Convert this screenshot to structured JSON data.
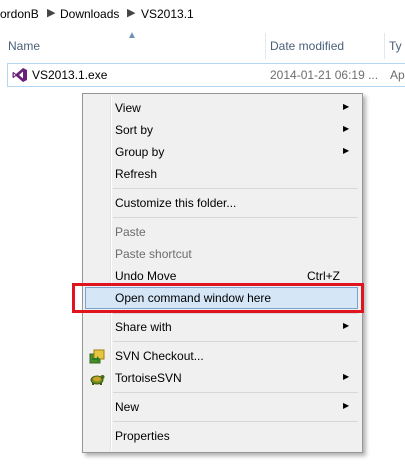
{
  "breadcrumb": {
    "items": [
      "ordonB",
      "Downloads",
      "VS2013.1"
    ],
    "separator": "▶"
  },
  "columns": {
    "name": "Name",
    "date_modified": "Date modified",
    "type": "Ty"
  },
  "file": {
    "name": "VS2013.1.exe",
    "date": "2014-01-21 06:19 ...",
    "type": "Ap",
    "icon": "visual-studio-icon"
  },
  "menu": {
    "view": "View",
    "sort_by": "Sort by",
    "group_by": "Group by",
    "refresh": "Refresh",
    "customize": "Customize this folder...",
    "paste": "Paste",
    "paste_shortcut": "Paste shortcut",
    "undo_move": "Undo Move",
    "undo_shortcut": "Ctrl+Z",
    "open_command": "Open command window here",
    "share_with": "Share with",
    "svn_checkout": "SVN Checkout...",
    "tortoise_svn": "TortoiseSVN",
    "new": "New",
    "properties": "Properties"
  },
  "colors": {
    "highlight_bg": "#d5e6f7",
    "highlight_border": "#7da2ce",
    "annotation_red": "#e0141e",
    "vs_purple": "#68217a"
  }
}
